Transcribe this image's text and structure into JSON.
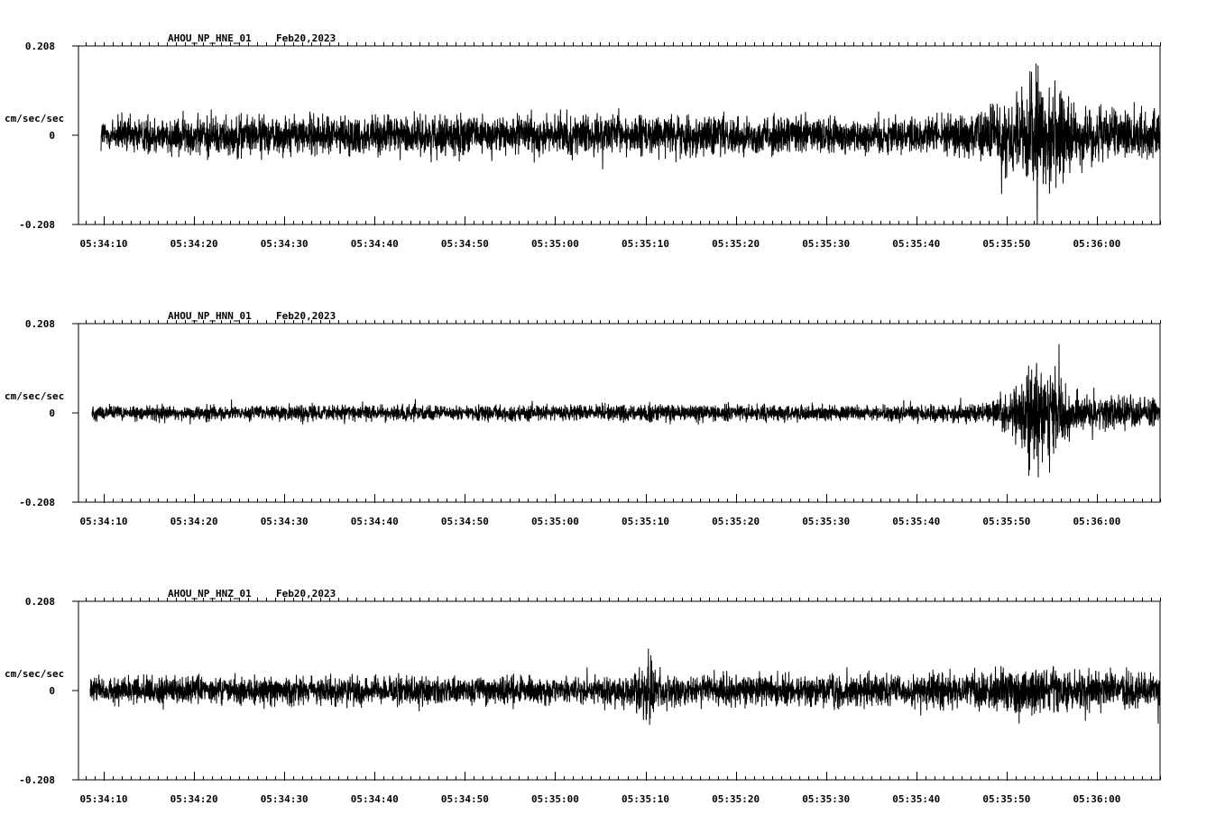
{
  "chart_data": [
    {
      "type": "line",
      "station": "AHOU_NP_HNE_01",
      "date": "Feb20,2023",
      "ylabel": "cm/sec/sec",
      "ylim": [
        -0.208,
        0.208
      ],
      "ytick_labels": [
        "0.208",
        "0",
        "-0.208"
      ],
      "xlim": [
        "05:34:07.2",
        "05:36:07"
      ],
      "xtick_labels": [
        "05:34:10",
        "05:34:20",
        "05:34:30",
        "05:34:40",
        "05:34:50",
        "05:35:00",
        "05:35:10",
        "05:35:20",
        "05:35:30",
        "05:35:40",
        "05:35:50",
        "05:36:00"
      ],
      "trace_start": "05:34:09.7",
      "trace_end": "05:36:07",
      "envelope": [
        {
          "t": "05:34:10",
          "amp": 0.06
        },
        {
          "t": "05:34:20",
          "amp": 0.065
        },
        {
          "t": "05:34:40",
          "amp": 0.065
        },
        {
          "t": "05:35:00",
          "amp": 0.062
        },
        {
          "t": "05:35:10",
          "amp": 0.065
        },
        {
          "t": "05:35:40",
          "amp": 0.062
        },
        {
          "t": "05:35:46",
          "amp": 0.07
        },
        {
          "t": "05:35:51",
          "amp": 0.14
        },
        {
          "t": "05:35:53.5",
          "amp": 0.208
        },
        {
          "t": "05:35:55.5",
          "amp": 0.16
        },
        {
          "t": "05:35:58",
          "amp": 0.09
        },
        {
          "t": "05:36:07",
          "amp": 0.075
        }
      ]
    },
    {
      "type": "line",
      "station": "AHOU_NP_HNN_01",
      "date": "Feb20,2023",
      "ylabel": "cm/sec/sec",
      "ylim": [
        -0.208,
        0.208
      ],
      "ytick_labels": [
        "0.208",
        "0",
        "-0.208"
      ],
      "xlim": [
        "05:34:07.2",
        "05:36:07"
      ],
      "xtick_labels": [
        "05:34:10",
        "05:34:20",
        "05:34:30",
        "05:34:40",
        "05:34:50",
        "05:35:00",
        "05:35:10",
        "05:35:20",
        "05:35:30",
        "05:35:40",
        "05:35:50",
        "05:36:00"
      ],
      "trace_start": "05:34:08.7",
      "trace_end": "05:36:07",
      "envelope": [
        {
          "t": "05:34:10",
          "amp": 0.025
        },
        {
          "t": "05:34:40",
          "amp": 0.025
        },
        {
          "t": "05:35:00",
          "amp": 0.025
        },
        {
          "t": "05:35:10",
          "amp": 0.03
        },
        {
          "t": "05:35:40",
          "amp": 0.025
        },
        {
          "t": "05:35:48",
          "amp": 0.035
        },
        {
          "t": "05:35:51",
          "amp": 0.09
        },
        {
          "t": "05:35:53.5",
          "amp": 0.2
        },
        {
          "t": "05:35:55",
          "amp": 0.16
        },
        {
          "t": "05:35:58",
          "amp": 0.06
        },
        {
          "t": "05:36:07",
          "amp": 0.04
        }
      ]
    },
    {
      "type": "line",
      "station": "AHOU_NP_HNZ_01",
      "date": "Feb20,2023",
      "ylabel": "cm/sec/sec",
      "ylim": [
        -0.208,
        0.208
      ],
      "ytick_labels": [
        "0.208",
        "0",
        "-0.208"
      ],
      "xlim": [
        "05:34:07.2",
        "05:36:07"
      ],
      "xtick_labels": [
        "05:34:10",
        "05:34:20",
        "05:34:30",
        "05:34:40",
        "05:34:50",
        "05:35:00",
        "05:35:10",
        "05:35:20",
        "05:35:30",
        "05:35:40",
        "05:35:50",
        "05:36:00"
      ],
      "trace_start": "05:34:08.5",
      "trace_end": "05:36:07",
      "envelope": [
        {
          "t": "05:34:10",
          "amp": 0.045
        },
        {
          "t": "05:34:40",
          "amp": 0.045
        },
        {
          "t": "05:35:08",
          "amp": 0.045
        },
        {
          "t": "05:35:10.5",
          "amp": 0.11
        },
        {
          "t": "05:35:12",
          "amp": 0.05
        },
        {
          "t": "05:35:40",
          "amp": 0.05
        },
        {
          "t": "05:35:52",
          "amp": 0.08
        },
        {
          "t": "05:36:07",
          "amp": 0.055
        }
      ]
    }
  ]
}
